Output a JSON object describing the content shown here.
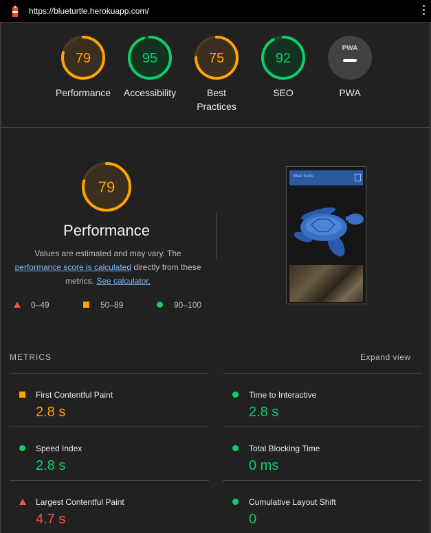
{
  "browser": {
    "url": "https://blueturtle.herokuapp.com/"
  },
  "colors": {
    "pass": "#0cce6b",
    "average": "#ffa400",
    "fail": "#ff4e42",
    "link": "#7eb4f5"
  },
  "gauges": [
    {
      "score": "79",
      "label_1": "Performance",
      "label_2": "",
      "color": "#ffa400"
    },
    {
      "score": "95",
      "label_1": "Accessibility",
      "label_2": "",
      "color": "#0cce6b"
    },
    {
      "score": "75",
      "label_1": "Best",
      "label_2": "Practices",
      "color": "#ffa400"
    },
    {
      "score": "92",
      "label_1": "SEO",
      "label_2": "",
      "color": "#0cce6b"
    },
    {
      "score": "",
      "label_1": "PWA",
      "label_2": "",
      "color": "#9e9e9e"
    }
  ],
  "pwa_badge": {
    "text": "PWA"
  },
  "performance": {
    "score": "79",
    "title": "Performance",
    "desc_1": "Values are estimated and may vary. The",
    "link_1": "performance score is calculated",
    "desc_2": " directly from these",
    "desc_3": "metrics. ",
    "link_2": "See calculator."
  },
  "legend": [
    {
      "icon": "triangle-icon",
      "range": "0–49"
    },
    {
      "icon": "square-icon",
      "range": "50–89"
    },
    {
      "icon": "circle-icon",
      "range": "90–100"
    }
  ],
  "screenshot": {
    "site_title": "Blue Turtle"
  },
  "metrics_header": {
    "title": "METRICS",
    "expand": "Expand view"
  },
  "metrics": [
    {
      "name": "First Contentful Paint",
      "value": "2.8 s",
      "rating": "average"
    },
    {
      "name": "Time to Interactive",
      "value": "2.8 s",
      "rating": "pass"
    },
    {
      "name": "Speed Index",
      "value": "2.8 s",
      "rating": "pass"
    },
    {
      "name": "Total Blocking Time",
      "value": "0 ms",
      "rating": "pass"
    },
    {
      "name": "Largest Contentful Paint",
      "value": "4.7 s",
      "rating": "fail"
    },
    {
      "name": "Cumulative Layout Shift",
      "value": "0",
      "rating": "pass"
    }
  ]
}
